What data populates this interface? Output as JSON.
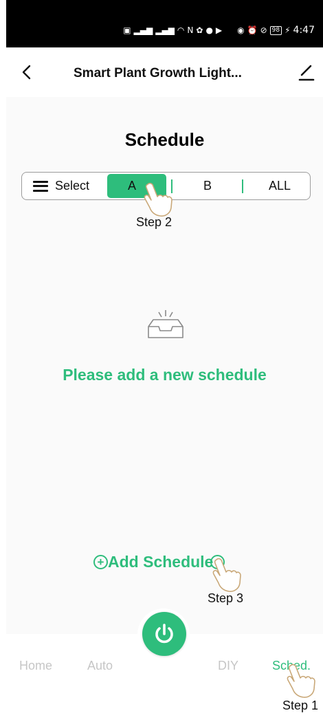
{
  "status_bar": {
    "left_icons": [
      "hd-icon",
      "signal-5g-icon",
      "signal-4g-icon",
      "wifi-icon",
      "nfc-icon",
      "paw-icon",
      "wechat-icon",
      "media-icon"
    ],
    "right_icons": [
      "eye-icon",
      "alarm-icon",
      "mute-icon"
    ],
    "battery": "98",
    "time": "4:47"
  },
  "app_bar": {
    "title": "Smart Plant Growth Light..."
  },
  "page": {
    "title": "Schedule",
    "segment": {
      "select_label": "Select",
      "option_a": "A",
      "option_b": "B",
      "option_all": "ALL",
      "selected": "A"
    },
    "empty_message": "Please add a new schedule",
    "add_schedule_label": "Add Schedule"
  },
  "steps": {
    "step1": "Step 1",
    "step2": "Step 2",
    "step3": "Step 3"
  },
  "tabs": [
    {
      "label": "Home",
      "active": false
    },
    {
      "label": "Auto",
      "active": false
    },
    {
      "label": "DIY",
      "active": false
    },
    {
      "label": "Sched.",
      "active": true
    }
  ],
  "colors": {
    "accent": "#2ebd7c",
    "inactive_tab": "#c6c6c6",
    "status_bar": "#000000"
  }
}
